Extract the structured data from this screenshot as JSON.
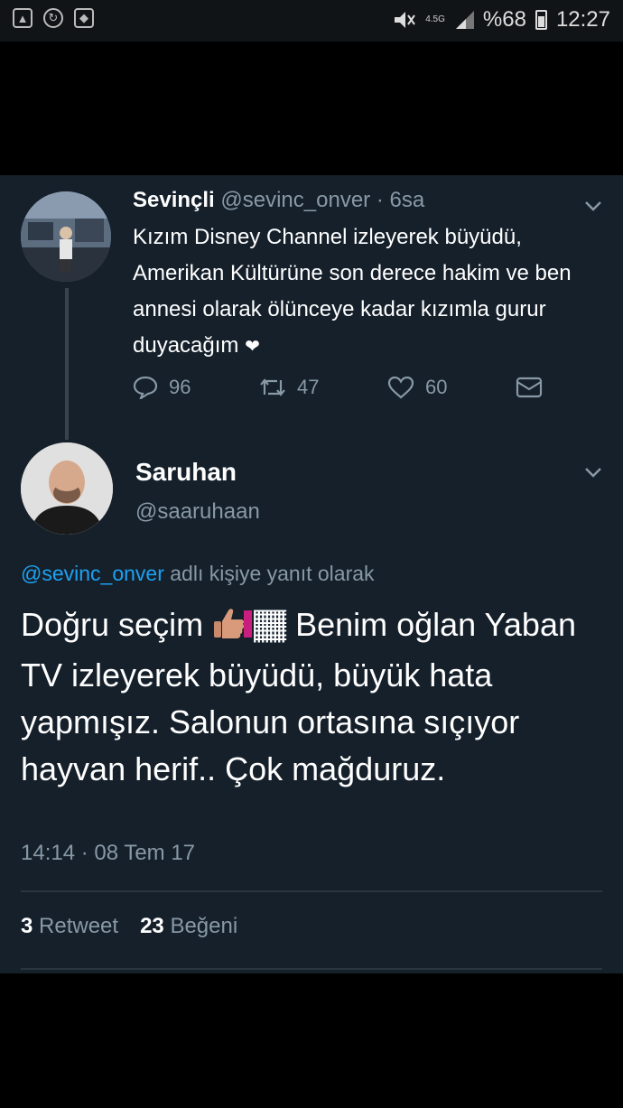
{
  "status_bar": {
    "network": "4.5G",
    "battery_percent": "%68",
    "time": "12:27"
  },
  "tweet1": {
    "name": "Sevinçli",
    "handle": "@sevinc_onver",
    "time": "· 6sa",
    "text": "Kızım Disney Channel izleyerek büyüdü, Amerikan Kültürüne son derece hakim ve ben annesi olarak ölünceye kadar kızımla gurur duyacağım",
    "heart_emoji": "❤",
    "replies": "96",
    "retweets": "47",
    "likes": "60"
  },
  "tweet2": {
    "name": "Saruhan",
    "handle": "@saaruhaan",
    "reply_to_handle": "@sevinc_onver",
    "reply_to_suffix": " adlı kişiye yanıt olarak",
    "text_before_emoji": "Doğru seçim ",
    "emoji_trailer": "🏾",
    "text_after_emoji": " Benim oğlan Yaban TV izleyerek büyüdü, büyük hata yapmışız. Salonun ortasına sıçıyor hayvan herif.. Çok mağduruz.",
    "timestamp": "14:14 · 08 Tem 17",
    "retweet_count": "3",
    "retweet_label": "Retweet",
    "like_count": "23",
    "like_label": "Beğeni"
  },
  "icons": [
    "image-icon",
    "sync-icon",
    "android-icon",
    "mute-icon",
    "signal-icon",
    "battery-icon",
    "reply-icon",
    "retweet-icon",
    "like-icon",
    "message-icon",
    "chevron-down-icon",
    "thumbs-up-emoji"
  ]
}
